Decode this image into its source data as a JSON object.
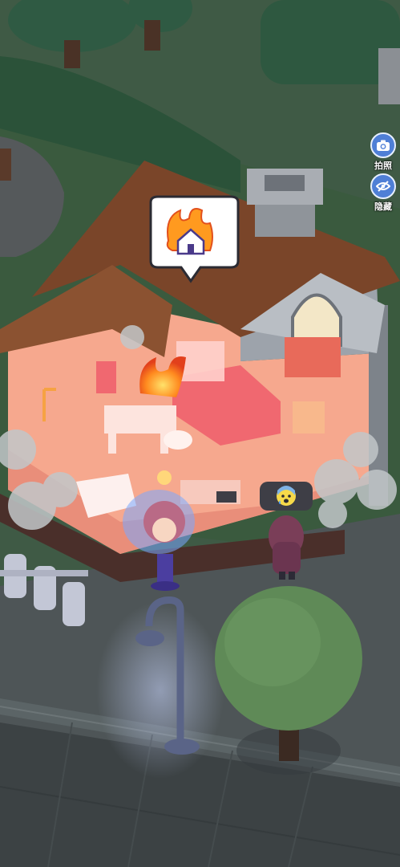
{
  "hud": {
    "camera_label": "拍照",
    "hide_label": "隐藏"
  },
  "status": {
    "house_alert_icon": "burning-house-icon",
    "character_emote_icon": "anxious-sweat-face-icon"
  },
  "colors": {
    "button_blue": "#4f7fd6",
    "room_glow": "#f6a88e",
    "roof": "#7a4529",
    "fire": "#ff8a1f"
  }
}
